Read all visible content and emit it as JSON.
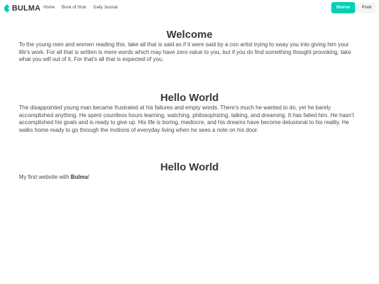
{
  "nav": {
    "brand": "BULMA",
    "items": [
      "Home",
      "Book of Strat",
      "Daily Journal"
    ],
    "primary_button": "Storror",
    "secondary_button": "Pook"
  },
  "sections": [
    {
      "title": "Welcome",
      "text": "To the young men and women reading this, take all that is said as if it were said by a con artist trying to sway you into giving him your life's work. For all that is written is mere words which may have zero value to you, but if you do find something thought provoking, take what you will out of it. For that's all that is expected of you."
    },
    {
      "title": "Hello World",
      "text": "The disappointed young man became frustrated at his failures and empty words. There's much he wanted to do, yet he barely accomplished anything. He spent countless hours learning, watching, philosophizing, talking, and dreaming. It has failed him. He hasn't accomplished his goals and is ready to give up. His life is boring, mediocre, and his dreams have become delusional to his reality. He walks home ready to go through the motions of everyday living when he sees a note on his door."
    },
    {
      "title": "Hello World",
      "text_before": "My first website with ",
      "text_strong": "Bulma",
      "text_after": "!"
    }
  ],
  "colors": {
    "primary": "#00d1b2",
    "text": "#4a4a4a",
    "heading": "#363636"
  }
}
